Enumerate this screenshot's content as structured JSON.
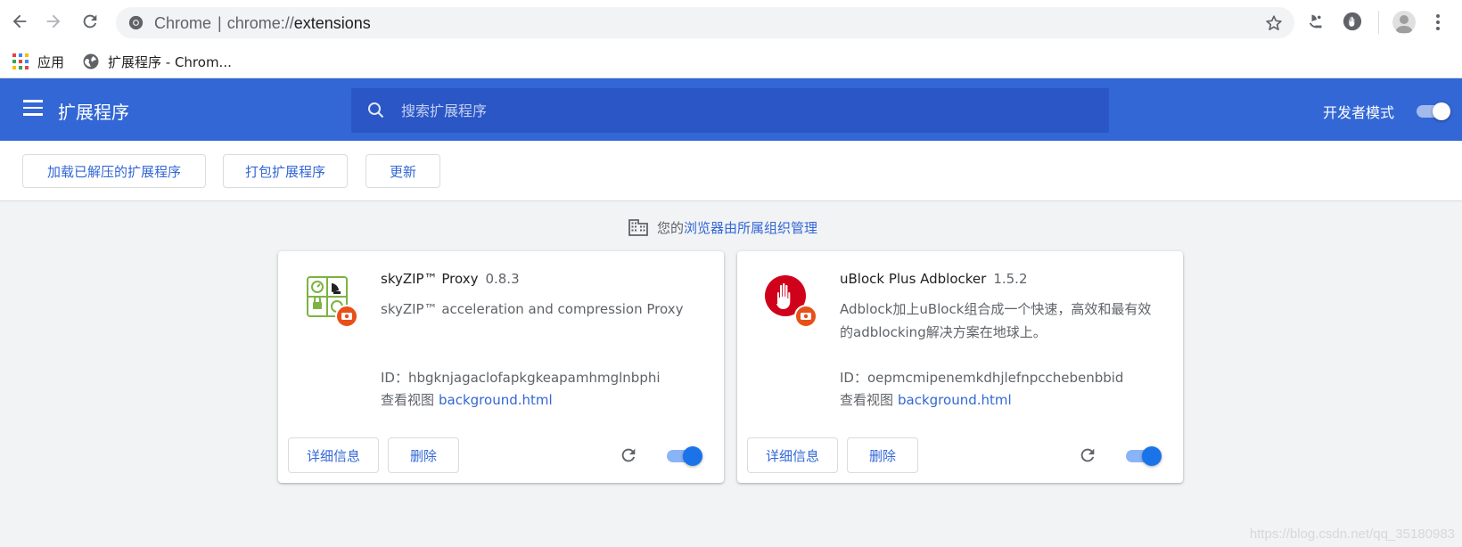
{
  "browser": {
    "site_label": "Chrome",
    "url_scheme": "chrome://",
    "url_path": "extensions"
  },
  "bookmarks": [
    {
      "label": "应用",
      "icon": "apps-grid-icon"
    },
    {
      "label": "扩展程序 - Chrom...",
      "icon": "globe-icon"
    }
  ],
  "header": {
    "title": "扩展程序",
    "search_placeholder": "搜索扩展程序",
    "dev_mode_label": "开发者模式",
    "dev_mode_on": true,
    "accent_color": "#3367d6"
  },
  "toolbar": {
    "load_unpacked": "加载已解压的扩展程序",
    "pack": "打包扩展程序",
    "update": "更新"
  },
  "managed": {
    "prefix": "您的",
    "link": "浏览器由所属组织管理"
  },
  "extensions": [
    {
      "name": "skyZIP™ Proxy",
      "version": "0.8.3",
      "description": "skyZIP™ acceleration and compression Proxy",
      "id_label": "ID：hbgknjagaclofapkgkeapamhmglnbphi",
      "view_label": "查看视图",
      "view_link": "background.html",
      "details_button": "详细信息",
      "remove_button": "删除",
      "enabled": true
    },
    {
      "name": "uBlock Plus Adblocker",
      "version": "1.5.2",
      "description": "Adblock加上uBlock组合成一个快速，高效和最有效的adblocking解决方案在地球上。",
      "id_label": "ID：oepmcmipenemkdhjlefnpcchebenbbid",
      "view_label": "查看视图",
      "view_link": "background.html",
      "details_button": "详细信息",
      "remove_button": "删除",
      "enabled": true
    }
  ],
  "watermark": "https://blog.csdn.net/qq_35180983"
}
